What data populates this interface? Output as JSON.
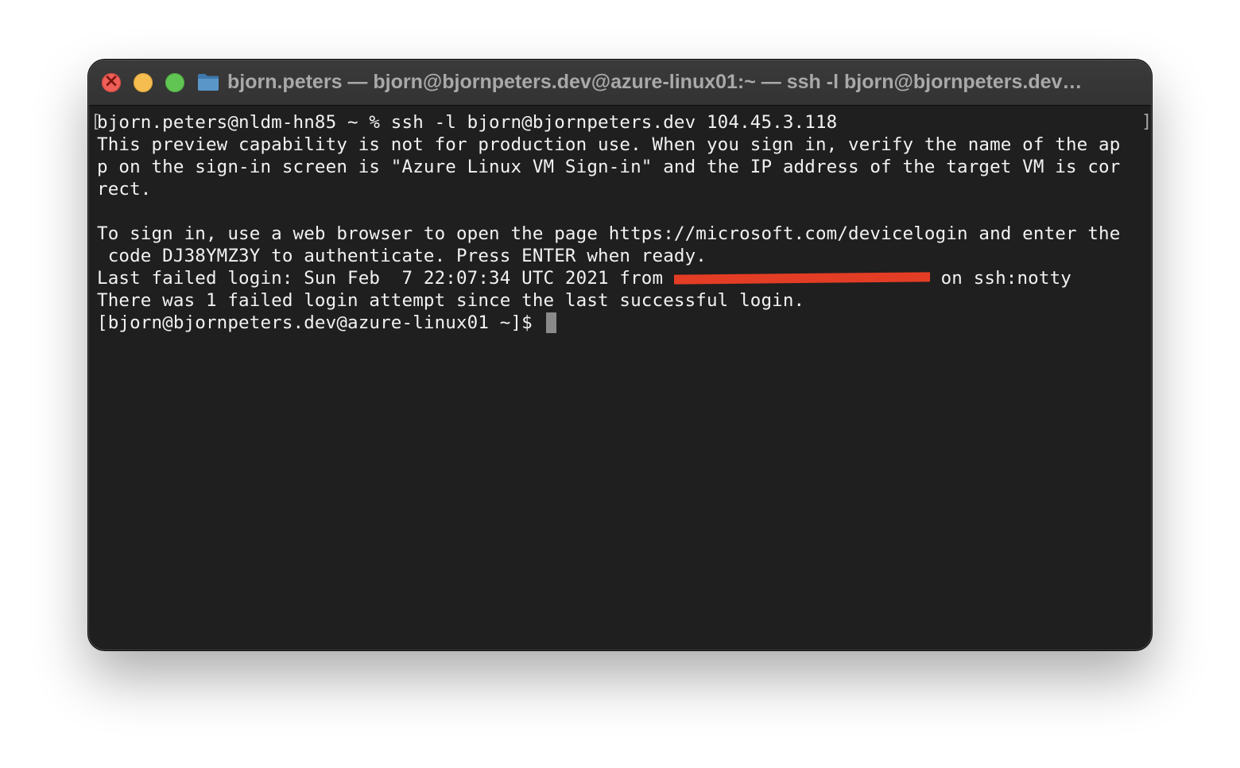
{
  "window": {
    "title": "bjorn.peters — bjorn@bjornpeters.dev@azure-linux01:~ — ssh -l bjorn@bjornpeters.dev…",
    "controls": {
      "close": "close-button",
      "minimize": "minimize-button",
      "zoom": "zoom-button"
    },
    "title_icon": "folder-icon",
    "colors": {
      "background": "#1f1f1f",
      "titlebar": "#363636",
      "text": "#f2f2f2",
      "close": "#ee5f57",
      "minimize": "#f5bd4f",
      "zoom": "#61c554",
      "redaction": "#e43d25"
    }
  },
  "terminal": {
    "command_line": "bjorn.peters@nldm-hn85 ~ % ssh -l bjorn@bjornpeters.dev 104.45.3.118",
    "mark_open": "[",
    "mark_close": "]",
    "output": [
      "This preview capability is not for production use. When you sign in, verify the name of the ap",
      "p on the sign-in screen is \"Azure Linux VM Sign-in\" and the IP address of the target VM is cor",
      "rect.",
      "",
      "To sign in, use a web browser to open the page https://microsoft.com/devicelogin and enter the",
      " code DJ38YMZ3Y to authenticate. Press ENTER when ready."
    ],
    "last_failed": {
      "prefix": "Last failed login: Sun Feb  7 22:07:34 UTC 2021 from ",
      "suffix": " on ssh:notty"
    },
    "failed_attempts": "There was 1 failed login attempt since the last successful login.",
    "prompt": "[bjorn@bjornpeters.dev@azure-linux01 ~]$ "
  }
}
